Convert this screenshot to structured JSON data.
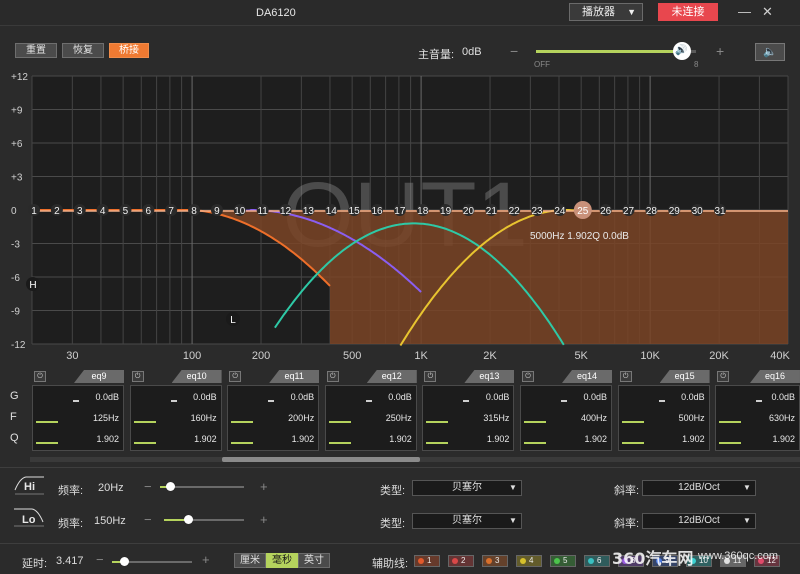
{
  "window": {
    "title": "DA6120",
    "player_label": "播放器",
    "connect_label": "未连接",
    "minimize": "—",
    "close": "✕"
  },
  "toolbar": {
    "reset_label": "重置",
    "restore_label": "恢复",
    "bridge_label": "桥接"
  },
  "master_volume": {
    "label": "主音量:",
    "value": "0dB",
    "min_label": "OFF",
    "max_label": "8",
    "minus": "−",
    "plus": "+",
    "level": 0.91
  },
  "colors": {
    "accent": "#ef7a32",
    "connect": "#e8474e",
    "slider": "#b5d35d",
    "curve_hp": "#ee6f2a",
    "curve_purple": "#8a5ef0",
    "curve_green": "#2ec9a6",
    "curve_yellow": "#e8c430",
    "fill": "#7a4426"
  },
  "graph": {
    "watermark": "OUT1",
    "y_ticks": [
      "+12",
      "+9",
      "+6",
      "+3",
      "0",
      "-3",
      "-6",
      "-9",
      "-12"
    ],
    "x_ticks": [
      "30",
      "100",
      "200",
      "500",
      "1K",
      "2K",
      "5K",
      "10K",
      "20K",
      "40K"
    ],
    "band_points": [
      "1",
      "2",
      "3",
      "4",
      "5",
      "6",
      "7",
      "8",
      "9",
      "10",
      "11",
      "12",
      "13",
      "14",
      "15",
      "16",
      "17",
      "18",
      "19",
      "20",
      "21",
      "22",
      "23",
      "24",
      "25",
      "26",
      "27",
      "28",
      "29",
      "30",
      "31"
    ],
    "selected_point": "25",
    "selected_info": "5000Hz  1.902Q  0.0dB",
    "h_marker": "H",
    "l_marker": "L"
  },
  "eq_labels": {
    "g": "G",
    "f": "F",
    "q": "Q"
  },
  "eq_bands": [
    {
      "name": "eq9",
      "gain": "0.0dB",
      "freq": "125Hz",
      "q": "1.902"
    },
    {
      "name": "eq10",
      "gain": "0.0dB",
      "freq": "160Hz",
      "q": "1.902"
    },
    {
      "name": "eq11",
      "gain": "0.0dB",
      "freq": "200Hz",
      "q": "1.902"
    },
    {
      "name": "eq12",
      "gain": "0.0dB",
      "freq": "250Hz",
      "q": "1.902"
    },
    {
      "name": "eq13",
      "gain": "0.0dB",
      "freq": "315Hz",
      "q": "1.902"
    },
    {
      "name": "eq14",
      "gain": "0.0dB",
      "freq": "400Hz",
      "q": "1.902"
    },
    {
      "name": "eq15",
      "gain": "0.0dB",
      "freq": "500Hz",
      "q": "1.902"
    },
    {
      "name": "eq16",
      "gain": "0.0dB",
      "freq": "630Hz",
      "q": "1.902"
    }
  ],
  "hi_filter": {
    "label": "Hi",
    "freq_label": "频率:",
    "freq_value": "20Hz",
    "type_label": "类型:",
    "type_value": "贝塞尔",
    "slope_label": "斜率:",
    "slope_value": "12dB/Oct",
    "level": 0.12
  },
  "lo_filter": {
    "label": "Lo",
    "freq_label": "频率:",
    "freq_value": "150Hz",
    "type_label": "类型:",
    "type_value": "贝塞尔",
    "slope_label": "斜率:",
    "slope_value": "12dB/Oct",
    "level": 0.3
  },
  "delay": {
    "label": "延时:",
    "value": "3.417",
    "level": 0.15,
    "units": [
      "厘米",
      "毫秒",
      "英寸"
    ],
    "active_unit": "毫秒"
  },
  "aux_lines": {
    "label": "辅助线:",
    "items": [
      {
        "n": "1",
        "color": "#e25a2c"
      },
      {
        "n": "2",
        "color": "#d94848"
      },
      {
        "n": "3",
        "color": "#d9702c"
      },
      {
        "n": "4",
        "color": "#d6c12c"
      },
      {
        "n": "5",
        "color": "#4cc44c"
      },
      {
        "n": "6",
        "color": "#3ac0c0"
      },
      {
        "n": "8",
        "color": "#9a5ce0"
      },
      {
        "n": "9",
        "color": "#4a78e0"
      },
      {
        "n": "10",
        "color": "#3ad0d0"
      },
      {
        "n": "11",
        "color": "#e0e0e0"
      },
      {
        "n": "12",
        "color": "#e04a6a"
      }
    ]
  },
  "watermark": {
    "brand": "360汽车网",
    "url": "www.360qc.com"
  }
}
